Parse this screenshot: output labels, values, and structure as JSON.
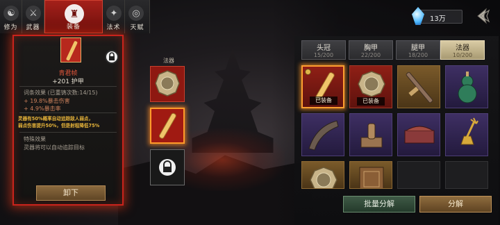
{
  "top_tabs": [
    {
      "label": "修为",
      "icon": "meditation-icon",
      "active": false
    },
    {
      "label": "武器",
      "icon": "sword-icon",
      "active": false
    },
    {
      "label": "装备",
      "icon": "robe-icon",
      "active": true
    },
    {
      "label": "法术",
      "icon": "spell-icon",
      "active": false
    },
    {
      "label": "天赋",
      "icon": "talent-icon",
      "active": false
    }
  ],
  "currency": {
    "amount": "13万",
    "icon": "spirit-gem-icon",
    "color": "#49b6ff"
  },
  "detail": {
    "name": "青君帧",
    "main_stat": "+201 护甲",
    "affix_header": "词条效果",
    "affix_note": "(已重铸次数:14/15)",
    "affixes": [
      "+ 19.8%暴击伤害",
      "+ 4.9%暴击率"
    ],
    "gold_text_1": "灵器有50%概率自动追踪敌人弱点，",
    "gold_text_2": "弱点伤害提升50%，但是射程降低75%",
    "special_header": "特殊效果",
    "special_text": "灵器将可以自动追踪目标",
    "unequip_label": "卸下",
    "accent_color": "#c9231c"
  },
  "slot_column": {
    "title": "法器"
  },
  "inventory": {
    "tabs": [
      {
        "name": "头冠",
        "count": "15/200",
        "active": false
      },
      {
        "name": "胸甲",
        "count": "22/200",
        "active": false
      },
      {
        "name": "腿甲",
        "count": "18/200",
        "active": false
      },
      {
        "name": "法器",
        "count": "10/200",
        "active": true
      }
    ],
    "items": [
      {
        "icon": "wooden-slip-icon",
        "rarity": "red",
        "equipped": "已装备",
        "selected": true
      },
      {
        "icon": "bagua-mirror-icon",
        "rarity": "red",
        "equipped": "已装备",
        "selected": false
      },
      {
        "icon": "iron-ruler-icon",
        "rarity": "gold",
        "equipped": "",
        "selected": false
      },
      {
        "icon": "gourd-icon",
        "rarity": "purple",
        "equipped": "",
        "selected": false
      },
      {
        "icon": "horn-icon",
        "rarity": "purple",
        "equipped": "",
        "selected": false
      },
      {
        "icon": "seal-stamp-icon",
        "rarity": "purple",
        "equipped": "",
        "selected": false
      },
      {
        "icon": "dragon-box-icon",
        "rarity": "purple",
        "equipped": "",
        "selected": false
      },
      {
        "icon": "trident-bell-icon",
        "rarity": "purple",
        "equipped": "",
        "selected": false
      },
      {
        "icon": "bagua-mirror-icon",
        "rarity": "gold",
        "equipped": "",
        "selected": false
      },
      {
        "icon": "carved-box-icon",
        "rarity": "gold",
        "equipped": "",
        "selected": false
      },
      {
        "icon": "",
        "rarity": "empty",
        "equipped": "",
        "selected": false
      },
      {
        "icon": "",
        "rarity": "empty",
        "equipped": "",
        "selected": false
      }
    ],
    "batch_label": "批量分解",
    "decompose_label": "分解"
  }
}
